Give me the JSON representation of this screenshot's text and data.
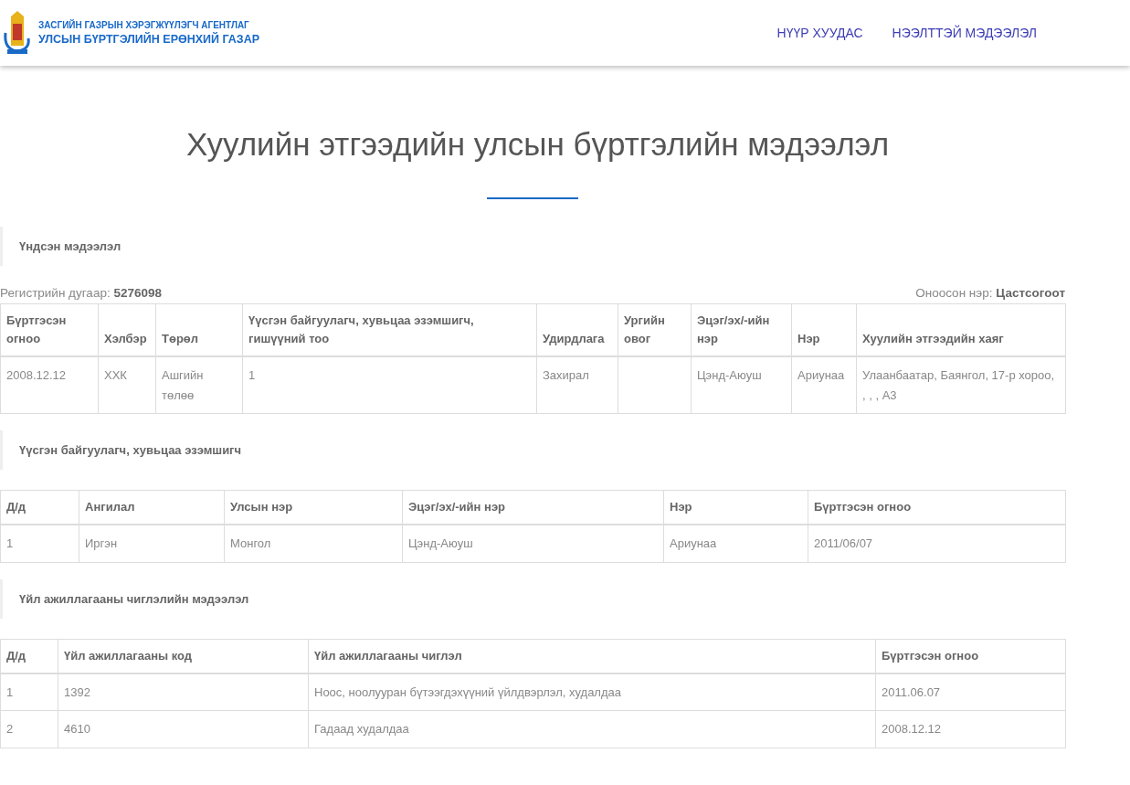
{
  "header": {
    "agency_line_1": "ЗАСГИЙН ГАЗРЫН ХЭРЭГЖҮҮЛЭГЧ АГЕНТЛАГ",
    "agency_line_2": "УЛСЫН БҮРТГЭЛИЙН ЕРӨНХИЙ ГАЗАР",
    "nav": [
      {
        "label": "НҮҮР ХУУДАС"
      },
      {
        "label": "НЭЭЛТТЭЙ МЭДЭЭЛЭЛ"
      }
    ]
  },
  "page_title": "Хуулийн этгээдийн улсын бүртгэлийн мэдээлэл",
  "sections": [
    {
      "title": "Үндсэн мэдээлэл",
      "meta": {
        "left_label": "Регистрийн дугаар:",
        "left_value": "5276098",
        "right_label": "Оноосон нэр:",
        "right_value": "Цастсогоот"
      },
      "columns": [
        "Бүртгэсэн огноо",
        "Хэлбэр",
        "Төрөл",
        "Үүсгэн байгуулагч, хувьцаа эзэмшигч, гишүүний тоо",
        "Удирдлага",
        "Ургийн овог",
        "Эцэг/эх/-ийн нэр",
        "Нэр",
        "Хуулийн этгээдийн хаяг"
      ],
      "rows": [
        [
          "2008.12.12",
          "ХХК",
          "Ашгийн төлөө",
          "1",
          "Захирал",
          "",
          "Цэнд-Аюуш",
          "Ариунаа",
          "Улаанбаатар, Баянгол, 17-р хороо, , , , А3"
        ]
      ]
    },
    {
      "title": "Үүсгэн байгуулагч, хувьцаа эзэмшигч",
      "columns": [
        "Д/д",
        "Ангилал",
        "Улсын нэр",
        "Эцэг/эх/-ийн нэр",
        "Нэр",
        "Бүртгэсэн огноо"
      ],
      "rows": [
        [
          "1",
          "Иргэн",
          "Монгол",
          "Цэнд-Аюуш",
          "Ариунаа",
          "2011/06/07"
        ]
      ]
    },
    {
      "title": "Үйл ажиллагааны чиглэлийн мэдээлэл",
      "columns": [
        "Д/д",
        "Үйл ажиллагааны код",
        "Үйл ажиллагааны чиглэл",
        "Бүртгэсэн огноо"
      ],
      "rows": [
        [
          "1",
          "1392",
          "Ноос, ноолууран бүтээгдэхүүний үйлдвэрлэл, худалдаа",
          "2011.06.07"
        ],
        [
          "2",
          "4610",
          "Гадаад худалдаа",
          "2008.12.12"
        ]
      ]
    }
  ]
}
